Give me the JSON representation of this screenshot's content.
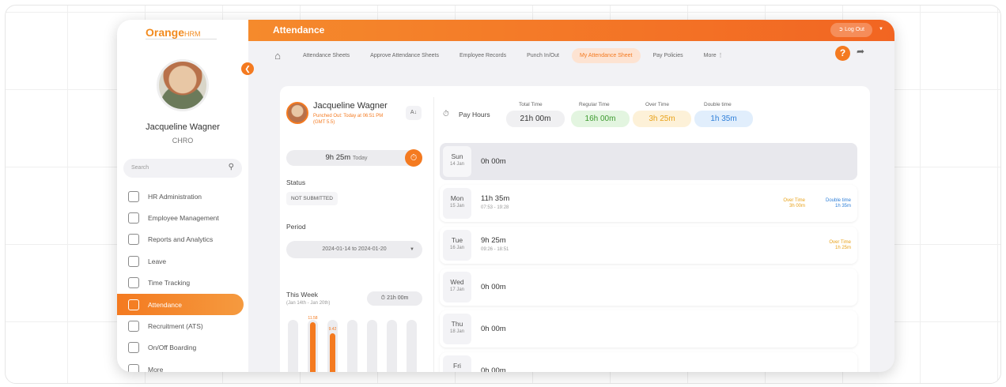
{
  "app": {
    "logo_main": "Orange",
    "logo_suffix": "HRM",
    "page_title": "Attendance",
    "logout_label": "Log Out"
  },
  "sidebar": {
    "user_name": "Jacqueline Wagner",
    "user_role": "CHRO",
    "search_placeholder": "Search",
    "items": [
      {
        "label": "HR Administration"
      },
      {
        "label": "Employee Management"
      },
      {
        "label": "Reports and Analytics"
      },
      {
        "label": "Leave"
      },
      {
        "label": "Time Tracking"
      },
      {
        "label": "Attendance"
      },
      {
        "label": "Recruitment (ATS)"
      },
      {
        "label": "On/Off Boarding"
      },
      {
        "label": "More"
      }
    ]
  },
  "menubar": {
    "items": [
      {
        "label": "Attendance Sheets"
      },
      {
        "label": "Approve Attendance Sheets"
      },
      {
        "label": "Employee Records"
      },
      {
        "label": "Punch In/Out"
      },
      {
        "label": "My Attendance Sheet"
      },
      {
        "label": "Pay Policies"
      },
      {
        "label": "More"
      }
    ],
    "help_label": "?"
  },
  "employee": {
    "name": "Jacqueline Wagner",
    "status_line1": "Punched Out: Today at 06:51 PM",
    "status_line2": "(GMT 5.5)",
    "today_hours": "9h 25m",
    "today_suffix": "Today",
    "status_label": "Status",
    "status_value": "NOT SUBMITTED",
    "period_label": "Period",
    "period_value": "2024-01-14 to 2024-01-20",
    "week_label": "This Week",
    "week_range": "(Jan 14th - Jan 20th)",
    "week_total": "21h 00m",
    "bar_values": [
      0,
      11.58,
      9.42,
      0,
      0,
      0,
      0
    ],
    "bar_labels": [
      "",
      "11.58",
      "9.42",
      "",
      "",
      "",
      ""
    ]
  },
  "pay": {
    "label": "Pay Hours",
    "total_label": "Total Time",
    "total_value": "21h 00m",
    "regular_label": "Regular Time",
    "regular_value": "16h 00m",
    "over_label": "Over Time",
    "over_value": "3h 25m",
    "double_label": "Double time",
    "double_value": "1h 35m"
  },
  "days": [
    {
      "name": "Sun",
      "date": "14 Jan",
      "hours": "0h 00m",
      "range": "",
      "ot": "",
      "dt": ""
    },
    {
      "name": "Mon",
      "date": "15 Jan",
      "hours": "11h 35m",
      "range": "07:53 - 19:28",
      "ot_label": "Over Time",
      "ot": "3h 00m",
      "dt_label": "Double time",
      "dt": "1h 35m"
    },
    {
      "name": "Tue",
      "date": "16 Jan",
      "hours": "9h 25m",
      "range": "09:26 - 18:51",
      "ot_label": "Over Time",
      "ot": "1h 25m",
      "dt": ""
    },
    {
      "name": "Wed",
      "date": "17 Jan",
      "hours": "0h 00m",
      "range": "",
      "ot": "",
      "dt": ""
    },
    {
      "name": "Thu",
      "date": "18 Jan",
      "hours": "0h 00m",
      "range": "",
      "ot": "",
      "dt": ""
    },
    {
      "name": "Fri",
      "date": "",
      "hours": "0h 00m",
      "range": "",
      "ot": "",
      "dt": ""
    }
  ],
  "colors": {
    "accent": "#f47a20",
    "total_bg": "#f0f0f2",
    "regular_bg": "#e3f5e0",
    "regular_fg": "#3c9a2e",
    "over_bg": "#fdf1d8",
    "over_fg": "#e8a21a",
    "double_bg": "#e1eefc",
    "double_fg": "#2f7fd8"
  }
}
